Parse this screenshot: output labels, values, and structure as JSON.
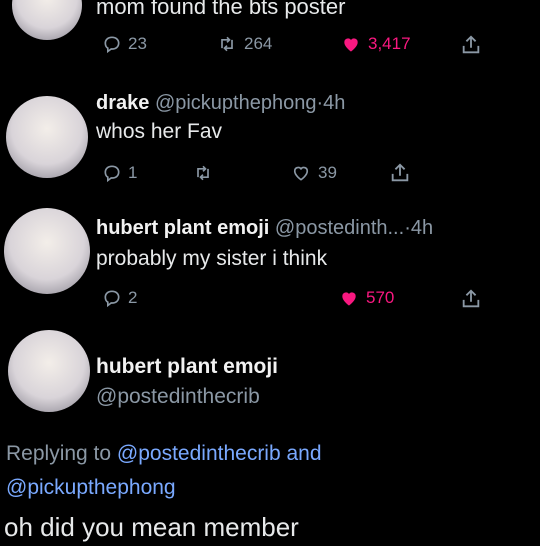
{
  "tweet1": {
    "text": "mom found the bts poster",
    "replies": "23",
    "retweets": "264",
    "likes": "3,417",
    "like_color": "#f91880"
  },
  "tweet2": {
    "name": "drake",
    "handle": "@pickupthephong",
    "dot": "·",
    "time": "4h",
    "text": "whos her Fav",
    "replies": "1",
    "likes": "39"
  },
  "tweet3": {
    "name": "hubert plant emoji",
    "handle": "@postedinth...",
    "dot": "·",
    "time": "4h",
    "text": "probably my sister i think",
    "replies": "2",
    "likes": "570"
  },
  "main": {
    "name": "hubert plant emoji",
    "handle": "@postedinthecrib",
    "replying_prefix": "Replying to",
    "mention1": "@postedinthecrib",
    "and": "and",
    "mention2": "@pickupthephong",
    "text": "oh did you mean member"
  },
  "colors": {
    "background": "#000000",
    "muted": "#8b98a5",
    "like": "#f91880",
    "mention": "#7aa9ff"
  }
}
